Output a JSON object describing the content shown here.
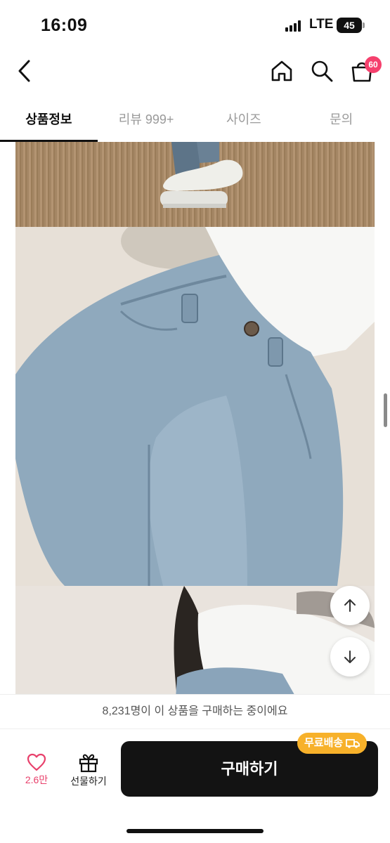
{
  "status_bar": {
    "time": "16:09",
    "network": "LTE",
    "battery": "45"
  },
  "header": {
    "cart_count": "60"
  },
  "tabs": [
    {
      "label": "상품정보",
      "active": true
    },
    {
      "label": "리뷰 999+",
      "active": false
    },
    {
      "label": "사이즈",
      "active": false
    },
    {
      "label": "문의",
      "active": false
    }
  ],
  "purchase_info": {
    "text": "8,231명이 이 상품을 구매하는 중이에요"
  },
  "actions": {
    "like_count": "2.6만",
    "gift_label": "선물하기",
    "buy_label": "구매하기",
    "free_shipping_badge": "무료배송"
  },
  "colors": {
    "accent_pink": "#f5406d",
    "badge_yellow": "#f7b12a",
    "buy_button": "#131313"
  }
}
